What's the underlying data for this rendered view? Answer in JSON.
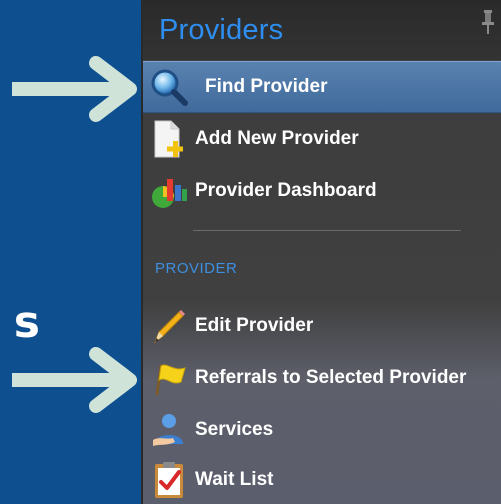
{
  "background": {
    "color": "#0d4f8f",
    "cropped_text": "s",
    "arrow_color": "#cfe3d8"
  },
  "panel": {
    "title": "Providers",
    "title_color": "#2d8ef0",
    "pin_icon": "pin-icon",
    "items": [
      {
        "label": "Find Provider",
        "icon": "magnifier-icon",
        "selected": true
      },
      {
        "label": "Add New Provider",
        "icon": "add-document-icon",
        "selected": false
      },
      {
        "label": "Provider Dashboard",
        "icon": "dashboard-chart-icon",
        "selected": false
      }
    ],
    "section": {
      "label": "PROVIDER",
      "items": [
        {
          "label": "Edit Provider",
          "icon": "pencil-icon"
        },
        {
          "label": "Referrals to Selected Provider",
          "icon": "flag-icon"
        },
        {
          "label": "Services",
          "icon": "person-services-icon"
        },
        {
          "label": "Wait List",
          "icon": "checklist-icon"
        }
      ]
    }
  }
}
